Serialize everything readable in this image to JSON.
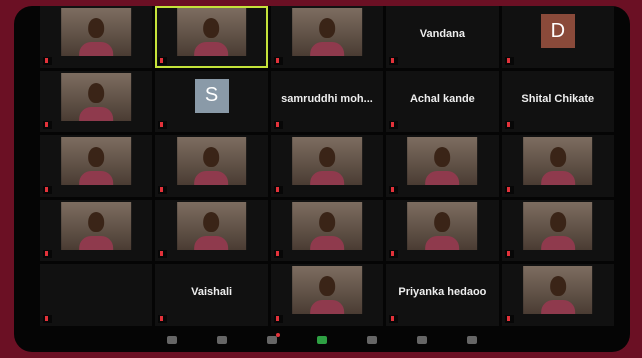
{
  "colors": {
    "outer_bg": "#6b1024",
    "stage_bg": "#050505",
    "active_speaker_border": "#c5e33a",
    "mic_muted": "#e3323a",
    "avatar_S": "#8a9aa8",
    "avatar_D": "#8a4a3a",
    "toolbar_green": "#2ea043"
  },
  "participants": [
    {
      "kind": "video",
      "label": "",
      "active": false
    },
    {
      "kind": "video",
      "label": "",
      "active": true
    },
    {
      "kind": "video",
      "label": "",
      "active": false
    },
    {
      "kind": "name",
      "display_name": "Vandana",
      "label": ""
    },
    {
      "kind": "avatar",
      "avatar_letter": "D",
      "avatar_color": "#8a4a3a",
      "label": ""
    },
    {
      "kind": "video",
      "label": "",
      "active": false
    },
    {
      "kind": "avatar",
      "avatar_letter": "S",
      "avatar_color": "#8a9aa8",
      "label": ""
    },
    {
      "kind": "name",
      "display_name": "samruddhi moh...",
      "label": ""
    },
    {
      "kind": "name",
      "display_name": "Achal kande",
      "label": ""
    },
    {
      "kind": "name",
      "display_name": "Shital Chikate",
      "label": ""
    },
    {
      "kind": "video",
      "label": "",
      "active": false
    },
    {
      "kind": "video",
      "label": "",
      "active": false
    },
    {
      "kind": "video",
      "label": "",
      "active": false
    },
    {
      "kind": "video",
      "label": "",
      "active": false
    },
    {
      "kind": "video",
      "label": "",
      "active": false
    },
    {
      "kind": "video",
      "label": "",
      "active": false
    },
    {
      "kind": "video",
      "label": "",
      "active": false
    },
    {
      "kind": "video",
      "label": "",
      "active": false
    },
    {
      "kind": "video",
      "label": "",
      "active": false
    },
    {
      "kind": "video",
      "label": "",
      "active": false
    },
    {
      "kind": "blank",
      "label": ""
    },
    {
      "kind": "name",
      "display_name": "Vaishali",
      "label": ""
    },
    {
      "kind": "video",
      "label": "",
      "active": false
    },
    {
      "kind": "name",
      "display_name": "Priyanka hedaoo",
      "label": ""
    },
    {
      "kind": "video",
      "label": "",
      "active": false
    }
  ],
  "toolbar": [
    {
      "icon": "mic-icon"
    },
    {
      "icon": "participants-icon"
    },
    {
      "icon": "chat-icon",
      "badge": true
    },
    {
      "icon": "share-screen-icon",
      "green": true
    },
    {
      "icon": "record-icon"
    },
    {
      "icon": "reactions-icon"
    },
    {
      "icon": "leave-icon"
    }
  ]
}
